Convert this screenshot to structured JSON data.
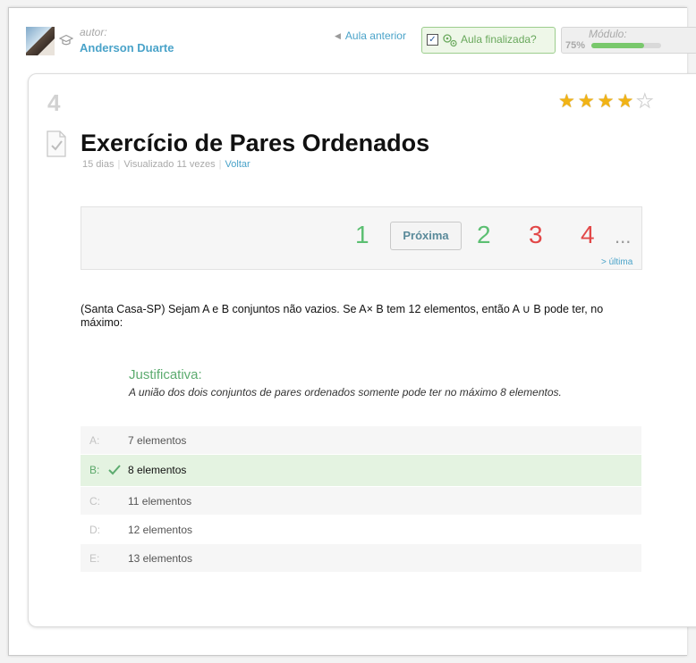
{
  "header": {
    "author_label": "autor:",
    "author_name": "Anderson Duarte",
    "prev_lesson": "Aula anterior",
    "finished_label": "Aula finalizada?",
    "finished_checked": true,
    "module_label": "Módulo:",
    "module_percent": "75%",
    "module_progress": 0.75
  },
  "lesson": {
    "number": "4",
    "title": "Exercício de Pares Ordenados",
    "age": "15 dias",
    "views": "Visualizado 11 vezes",
    "back": "Voltar",
    "rating": {
      "value": 4,
      "max": 5
    }
  },
  "pager": {
    "pages": [
      {
        "label": "1",
        "color": "#5cbf72"
      },
      {
        "label": "2",
        "color": "#5cbf72"
      },
      {
        "label": "3",
        "color": "#e24848"
      },
      {
        "label": "4",
        "color": "#e24848"
      }
    ],
    "next": "Próxima",
    "more": "...",
    "last": "> última"
  },
  "question": "(Santa Casa-SP) Sejam A e B conjuntos não vazios. Se A× B tem 12 elementos, então A ∪ B pode ter, no máximo:",
  "justification": {
    "title": "Justificativa:",
    "text": "A união dos dois conjuntos de pares ordenados somente pode ter no máximo 8 elementos."
  },
  "options": [
    {
      "letter": "A:",
      "text": "7 elementos",
      "correct": false
    },
    {
      "letter": "B:",
      "text": "8 elementos",
      "correct": true
    },
    {
      "letter": "C:",
      "text": "11 elementos",
      "correct": false
    },
    {
      "letter": "D:",
      "text": "12 elementos",
      "correct": false
    },
    {
      "letter": "E:",
      "text": "13 elementos",
      "correct": false
    }
  ],
  "colors": {
    "link": "#4aa3c9",
    "correct_bg": "#e4f3e1",
    "star": "#f1b315"
  },
  "icons": [
    "graduation-cap-icon",
    "checkbox-icon",
    "gears-icon",
    "star-icon",
    "document-check-icon",
    "checkmark-icon"
  ]
}
